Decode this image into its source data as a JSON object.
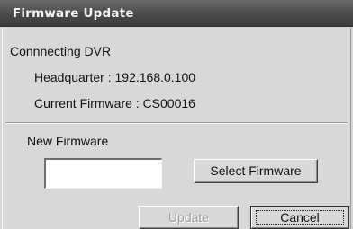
{
  "window": {
    "title": "Firmware Update"
  },
  "connection": {
    "heading": "Connnecting DVR",
    "headquarter_line": "Headquarter : 192.168.0.100",
    "firmware_line": "Current Firmware :  CS00016"
  },
  "new_firmware": {
    "label": "New Firmware",
    "path_value": "",
    "select_button": "Select Firmware"
  },
  "actions": {
    "update_button": "Update",
    "update_enabled": false,
    "cancel_button": "Cancel",
    "cancel_focused": true
  },
  "colors": {
    "titlebar": "#4a4a4a",
    "dialog_bg": "#d8d8d8",
    "disabled_text": "#9c9c9c"
  }
}
